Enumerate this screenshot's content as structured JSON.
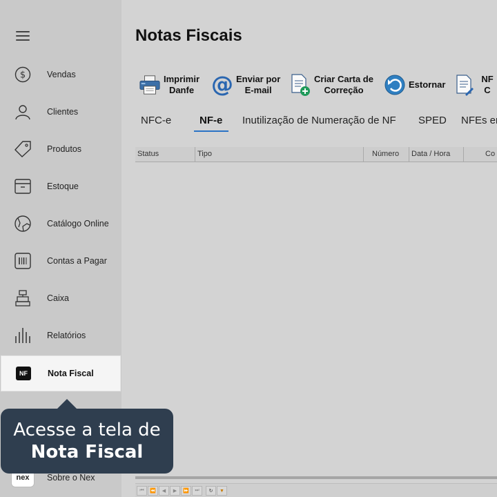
{
  "sidebar": {
    "items": [
      {
        "label": "Vendas",
        "icon": "dollar-circle-icon"
      },
      {
        "label": "Clientes",
        "icon": "user-icon"
      },
      {
        "label": "Produtos",
        "icon": "tag-icon"
      },
      {
        "label": "Estoque",
        "icon": "box-icon"
      },
      {
        "label": "Catálogo Online",
        "icon": "globe-icon"
      },
      {
        "label": "Contas a Pagar",
        "icon": "barcode-icon"
      },
      {
        "label": "Caixa",
        "icon": "cash-register-icon"
      },
      {
        "label": "Relatórios",
        "icon": "bar-chart-icon"
      },
      {
        "label": "Nota Fiscal",
        "icon": "nf-icon",
        "badge": "NF",
        "active": true
      }
    ],
    "about": {
      "label": "Sobre o Nex",
      "logo": "nex"
    }
  },
  "tooltip": {
    "line1": "Acesse a tela de",
    "line2": "Nota Fiscal"
  },
  "main": {
    "title": "Notas Fiscais",
    "toolbar": [
      {
        "label_line1": "Imprimir",
        "label_line2": "Danfe",
        "icon": "printer-icon"
      },
      {
        "label_line1": "Enviar por",
        "label_line2": "E-mail",
        "icon": "at-sign-icon"
      },
      {
        "label_line1": "Criar Carta de",
        "label_line2": "Correção",
        "icon": "document-add-icon"
      },
      {
        "label_line1": "Estornar",
        "icon": "undo-icon"
      },
      {
        "label_line1": "NF C",
        "icon": "document-edit-icon"
      }
    ],
    "tabs": [
      "NFC-e",
      "NF-e",
      "Inutilização de Numeração de NF",
      "SPED",
      "NFEs en"
    ],
    "active_tab": "NF-e",
    "grid": {
      "columns": [
        "Status",
        "Tipo",
        "Número",
        "Data / Hora",
        "Co"
      ]
    }
  },
  "colors": {
    "accent": "#2a73c5",
    "tooltip_bg": "#2f3e4f",
    "sidebar_bg": "#c9c9c9",
    "main_bg": "#d3d3d3"
  }
}
